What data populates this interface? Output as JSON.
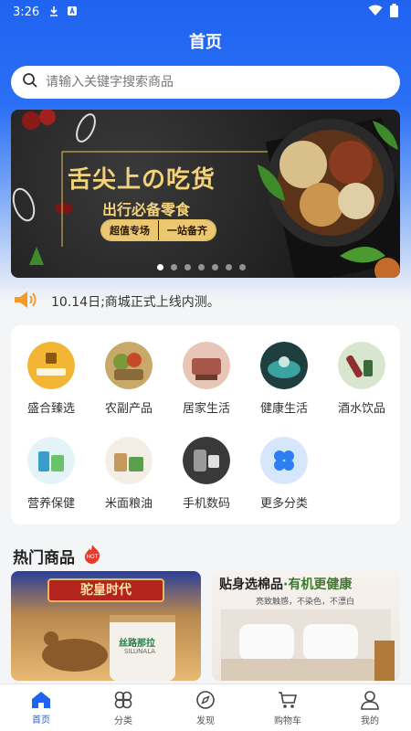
{
  "status_bar": {
    "time": "3:26"
  },
  "header": {
    "title": "首页"
  },
  "search": {
    "placeholder": "请输入关键字搜索商品"
  },
  "banner": {
    "headline": "舌尖上の吃货",
    "subline": "出行必备零食",
    "tags": [
      "超值专场",
      "一站备齐"
    ],
    "slide_count": 7,
    "active_slide": 1
  },
  "notice": {
    "text": "10.14日;商城正式上线内测。"
  },
  "categories": [
    {
      "label": "盛合臻选",
      "icon": "shenghe-logo-icon",
      "color": "#f2b634"
    },
    {
      "label": "农副产品",
      "icon": "produce-basket-icon",
      "color": "#7a9a3a"
    },
    {
      "label": "居家生活",
      "icon": "home-living-icon",
      "color": "#a8564a"
    },
    {
      "label": "健康生活",
      "icon": "health-spa-icon",
      "color": "#2f6a6a"
    },
    {
      "label": "酒水饮品",
      "icon": "wine-drinks-icon",
      "color": "#8f2f2f"
    },
    {
      "label": "营养保健",
      "icon": "supplements-icon",
      "color": "#3a9fc8"
    },
    {
      "label": "米面粮油",
      "icon": "grain-oil-icon",
      "color": "#c49a5a"
    },
    {
      "label": "手机数码",
      "icon": "phone-digital-icon",
      "color": "#555555"
    },
    {
      "label": "更多分类",
      "icon": "more-categories-icon",
      "color": "#2b7ff0"
    }
  ],
  "hot_section": {
    "title": "热门商品",
    "badge": "HOT"
  },
  "products": [
    {
      "title": "驼皇时代",
      "brand_text": "丝路那拉",
      "brand_sub": "SILUNALA"
    },
    {
      "title": "贴身选棉品",
      "title_green": "·有机更健康",
      "subtitle": "亮致触感，不染色，不漂白"
    }
  ],
  "nav": [
    {
      "label": "首页",
      "icon": "home-icon",
      "active": true
    },
    {
      "label": "分类",
      "icon": "category-icon",
      "active": false
    },
    {
      "label": "发现",
      "icon": "compass-icon",
      "active": false
    },
    {
      "label": "购物车",
      "icon": "cart-icon",
      "active": false
    },
    {
      "label": "我的",
      "icon": "user-icon",
      "active": false
    }
  ],
  "colors": {
    "primary": "#1f63f0",
    "background": "#f4f5f7",
    "banner_gold": "#f3d27a"
  }
}
